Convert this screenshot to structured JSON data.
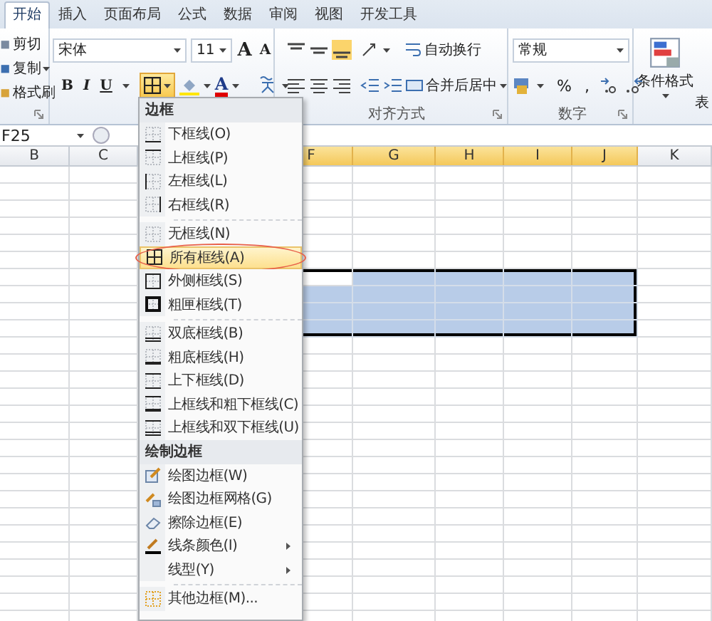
{
  "tabs": [
    {
      "label": "开始",
      "selected": true
    },
    {
      "label": "插入",
      "selected": false
    },
    {
      "label": "页面布局",
      "selected": false
    },
    {
      "label": "公式",
      "selected": false
    },
    {
      "label": "数据",
      "selected": false
    },
    {
      "label": "审阅",
      "selected": false
    },
    {
      "label": "视图",
      "selected": false
    },
    {
      "label": "开发工具",
      "selected": false
    }
  ],
  "clipboard": {
    "items": [
      "剪切",
      "复制",
      "格式刷"
    ]
  },
  "font": {
    "name": "宋体",
    "size": "11",
    "grow": "A",
    "shrink": "A",
    "bold": "B",
    "italic": "I",
    "underline": "U",
    "color_button": "A"
  },
  "alignment": {
    "wrap_text": "自动换行",
    "merge_center": "合并后居中",
    "label": "对齐方式"
  },
  "number": {
    "format": "常规",
    "percent": "%",
    "comma": ",",
    "label": "数字"
  },
  "styles": {
    "conditional_format": "条件格式",
    "cut_label": "表"
  },
  "formula_bar": {
    "name_box": "F25"
  },
  "sheet": {
    "columns": [
      {
        "label": "B",
        "selected": false
      },
      {
        "label": "C",
        "selected": false
      },
      {
        "label": "F",
        "selected": true
      },
      {
        "label": "G",
        "selected": true
      },
      {
        "label": "H",
        "selected": true
      },
      {
        "label": "I",
        "selected": true
      },
      {
        "label": "J",
        "selected": true
      },
      {
        "label": "K",
        "selected": false
      }
    ],
    "rows": [
      {
        "selected": false,
        "active": false
      },
      {
        "selected": false,
        "active": false
      },
      {
        "selected": false,
        "active": false
      },
      {
        "selected": false,
        "active": false
      },
      {
        "selected": false,
        "active": false
      },
      {
        "selected": false,
        "active": false
      },
      {
        "selected": true,
        "active": true
      },
      {
        "selected": true,
        "active": false
      },
      {
        "selected": true,
        "active": false
      },
      {
        "selected": true,
        "active": false
      },
      {
        "selected": false,
        "active": false
      },
      {
        "selected": false,
        "active": false
      },
      {
        "selected": false,
        "active": false
      },
      {
        "selected": false,
        "active": false
      },
      {
        "selected": false,
        "active": false
      },
      {
        "selected": false,
        "active": false
      },
      {
        "selected": false,
        "active": false
      },
      {
        "selected": false,
        "active": false
      },
      {
        "selected": false,
        "active": false
      },
      {
        "selected": false,
        "active": false
      },
      {
        "selected": false,
        "active": false
      },
      {
        "selected": false,
        "active": false
      },
      {
        "selected": false,
        "active": false
      },
      {
        "selected": false,
        "active": false
      },
      {
        "selected": false,
        "active": false
      },
      {
        "selected": false,
        "active": false
      },
      {
        "selected": false,
        "active": false
      }
    ]
  },
  "border_menu": {
    "items": [
      {
        "kind": "header",
        "label": "边框"
      },
      {
        "kind": "item",
        "label": "下框线(O)",
        "selected": false,
        "submenu": false
      },
      {
        "kind": "item",
        "label": "上框线(P)",
        "selected": false,
        "submenu": false
      },
      {
        "kind": "item",
        "label": "左框线(L)",
        "selected": false,
        "submenu": false
      },
      {
        "kind": "item",
        "label": "右框线(R)",
        "selected": false,
        "submenu": false
      },
      {
        "kind": "separator"
      },
      {
        "kind": "item",
        "label": "无框线(N)",
        "selected": false,
        "submenu": false
      },
      {
        "kind": "item",
        "label": "所有框线(A)",
        "selected": true,
        "submenu": false
      },
      {
        "kind": "item",
        "label": "外侧框线(S)",
        "selected": false,
        "submenu": false
      },
      {
        "kind": "item",
        "label": "粗匣框线(T)",
        "selected": false,
        "submenu": false
      },
      {
        "kind": "separator"
      },
      {
        "kind": "item",
        "label": "双底框线(B)",
        "selected": false,
        "submenu": false
      },
      {
        "kind": "item",
        "label": "粗底框线(H)",
        "selected": false,
        "submenu": false
      },
      {
        "kind": "item",
        "label": "上下框线(D)",
        "selected": false,
        "submenu": false
      },
      {
        "kind": "item",
        "label": "上框线和粗下框线(C)",
        "selected": false,
        "submenu": false
      },
      {
        "kind": "item",
        "label": "上框线和双下框线(U)",
        "selected": false,
        "submenu": false
      },
      {
        "kind": "header",
        "label": "绘制边框"
      },
      {
        "kind": "item",
        "label": "绘图边框(W)",
        "selected": false,
        "submenu": false
      },
      {
        "kind": "item",
        "label": "绘图边框网格(G)",
        "selected": false,
        "submenu": false
      },
      {
        "kind": "item",
        "label": "擦除边框(E)",
        "selected": false,
        "submenu": false
      },
      {
        "kind": "item",
        "label": "线条颜色(I)",
        "selected": false,
        "submenu": true
      },
      {
        "kind": "item",
        "label": "线型(Y)",
        "selected": false,
        "submenu": true
      },
      {
        "kind": "separator"
      },
      {
        "kind": "item",
        "label": "其他边框(M)...",
        "selected": false,
        "submenu": false
      }
    ]
  }
}
